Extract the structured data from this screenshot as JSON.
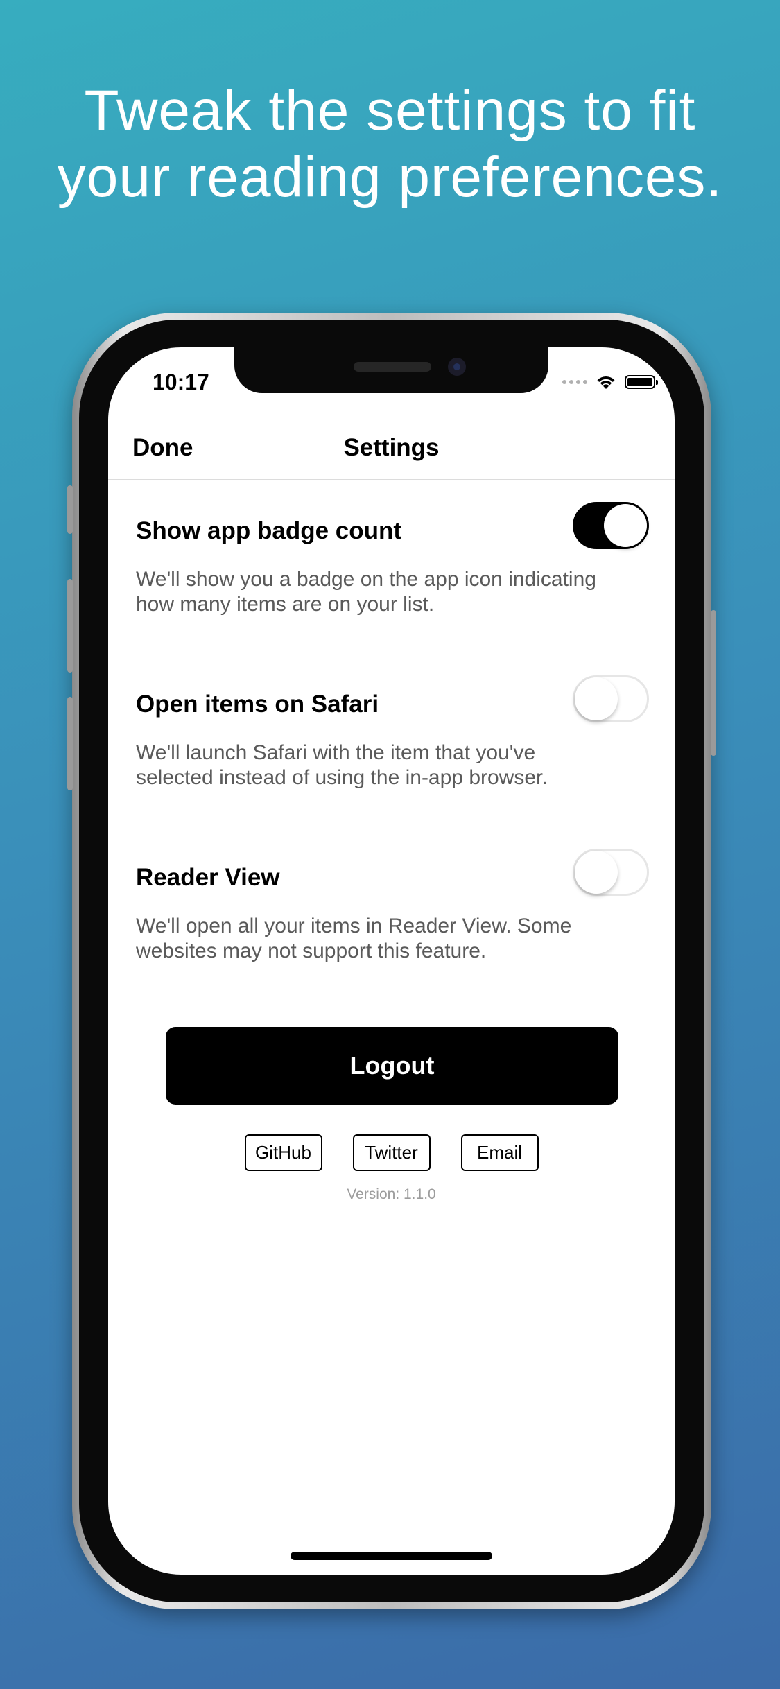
{
  "headline": {
    "line1": "Tweak the settings to fit",
    "line2": "your reading preferences."
  },
  "status_bar": {
    "time": "10:17",
    "icons": [
      "signal-dots-icon",
      "wifi-icon",
      "battery-icon"
    ]
  },
  "navbar": {
    "done_label": "Done",
    "title": "Settings"
  },
  "settings": [
    {
      "title": "Show app badge count",
      "description_line1": "We'll show you a badge on the app icon indicating",
      "description_line2": "how many items are on your list.",
      "enabled": true
    },
    {
      "title": "Open items on Safari",
      "description_line1": "We'll launch Safari with the item that you've",
      "description_line2": "selected instead of using the in-app browser.",
      "enabled": false
    },
    {
      "title": "Reader View",
      "description_line1": "We'll open all your items in Reader View. Some",
      "description_line2": "websites may not support this feature.",
      "enabled": false
    }
  ],
  "logout_label": "Logout",
  "links": {
    "github": "GitHub",
    "twitter": "Twitter",
    "email": "Email"
  },
  "version": "Version: 1.1.0",
  "colors": {
    "background_top": "#37adbf",
    "background_bottom": "#3b6ba8",
    "toggle_on": "#000000",
    "button": "#000000"
  }
}
